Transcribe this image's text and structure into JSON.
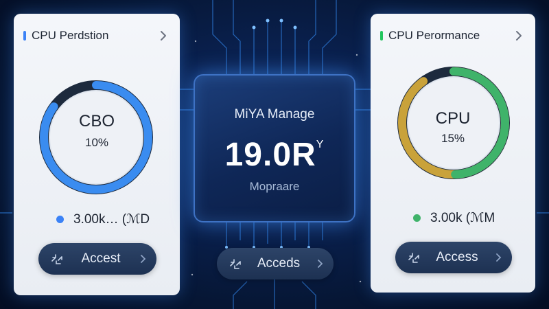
{
  "left_card": {
    "title": "CPU  Perdstion",
    "title_bar_color": "#3b82f6",
    "ring_color": "#3a8cf0",
    "ring_track_color": "#1d2a3d",
    "ring_percent": 85,
    "ring_label": "CBO",
    "ring_value": "10%",
    "stat_dot_color": "#3b82f6",
    "stat_text": "3.00k… (ℳD",
    "button_label": "Accest",
    "icons": {
      "header": "chevron-right-icon",
      "button": "connection-icon",
      "button_arrow": "chevron-right-icon"
    }
  },
  "center_chip": {
    "title": "MiYA Manage",
    "value": "19.0R",
    "value_suffix": "Y",
    "subtitle": "Mopraare",
    "button_label": "Acceds"
  },
  "right_card": {
    "title": "CPU  Perormance",
    "title_bar_color": "#22c55e",
    "ring_color_primary": "#3fb36a",
    "ring_color_secondary": "#c9a23a",
    "ring_track_color": "#1d2a3d",
    "ring_percent": 90,
    "ring_label": "CPU",
    "ring_value": "15%",
    "stat_dot_color": "#3fb36a",
    "stat_text": "3.00k (ℳM",
    "button_label": "Access"
  },
  "colors": {
    "background": "#0a2150",
    "circuit": "#2f7fe0",
    "accent_glow": "#4ea3ff"
  }
}
